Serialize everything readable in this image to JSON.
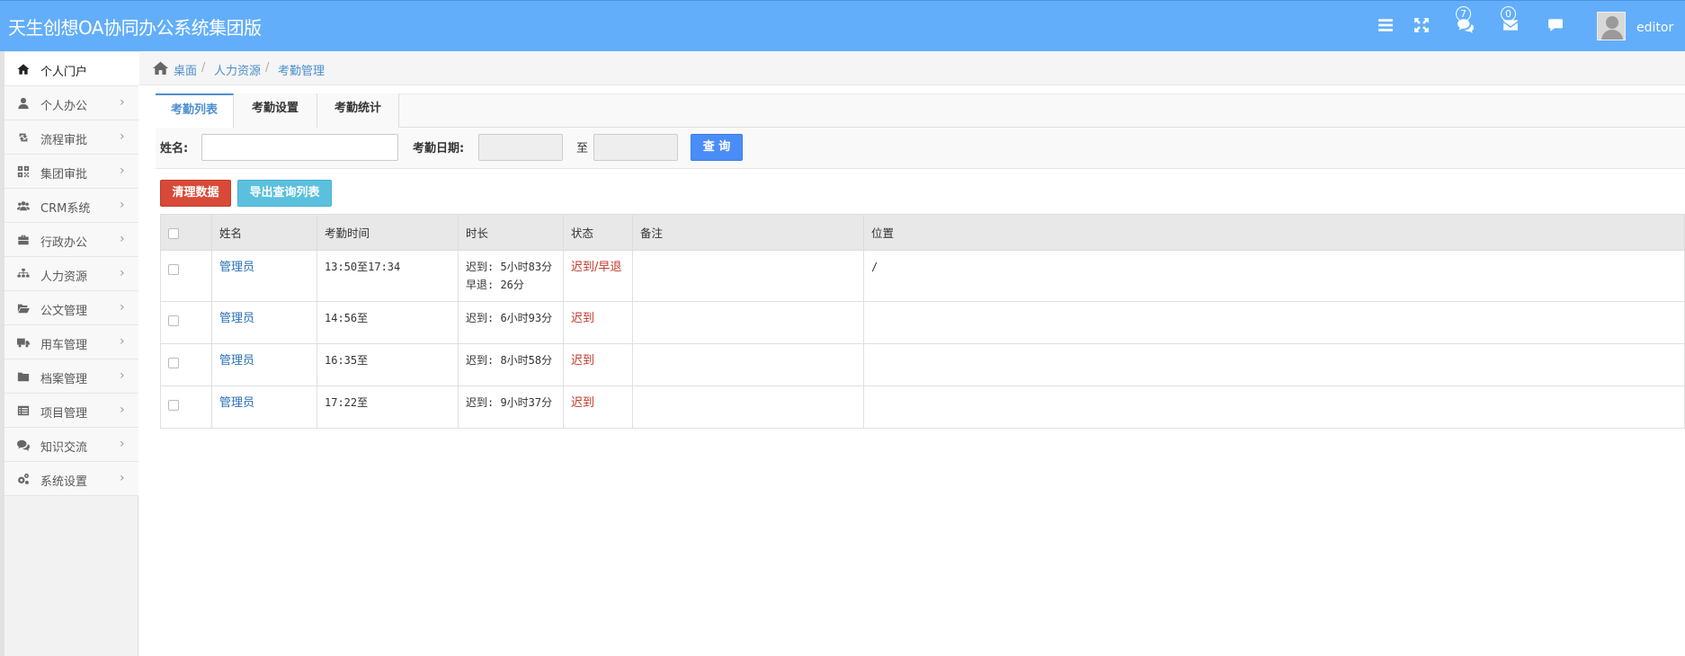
{
  "header": {
    "title": "天生创想OA协同办公系统集团版",
    "messages_badge": "7",
    "mail_badge": "0",
    "username": "editor"
  },
  "sidebar": {
    "items": [
      {
        "label": "个人门户",
        "icon": "home-icon"
      },
      {
        "label": "个人办公",
        "icon": "user-icon"
      },
      {
        "label": "流程审批",
        "icon": "retweet-icon"
      },
      {
        "label": "集团审批",
        "icon": "qrcode-icon"
      },
      {
        "label": "CRM系统",
        "icon": "group-icon"
      },
      {
        "label": "行政办公",
        "icon": "briefcase-icon"
      },
      {
        "label": "人力资源",
        "icon": "sitemap-icon"
      },
      {
        "label": "公文管理",
        "icon": "folder-open-icon"
      },
      {
        "label": "用车管理",
        "icon": "truck-icon"
      },
      {
        "label": "档案管理",
        "icon": "folder-icon"
      },
      {
        "label": "项目管理",
        "icon": "list-alt-icon"
      },
      {
        "label": "知识交流",
        "icon": "comments-icon"
      },
      {
        "label": "系统设置",
        "icon": "cogs-icon"
      }
    ]
  },
  "breadcrumb": {
    "items": [
      "桌面",
      "人力资源",
      "考勤管理"
    ],
    "sep": "/"
  },
  "tabs": [
    {
      "label": "考勤列表",
      "active": true
    },
    {
      "label": "考勤设置",
      "active": false
    },
    {
      "label": "考勤统计",
      "active": false
    }
  ],
  "search": {
    "name_label": "姓名:",
    "name_value": "",
    "date_label": "考勤日期:",
    "date_from": "",
    "to_label": "至",
    "date_to": "",
    "query_button": "查 询"
  },
  "actions": {
    "clear_button": "清理数据",
    "export_button": "导出查询列表"
  },
  "table": {
    "columns": [
      "姓名",
      "考勤时间",
      "时长",
      "状态",
      "备注",
      "位置"
    ],
    "rows": [
      {
        "name": "管理员",
        "time": "13:50至17:34",
        "duration": [
          "迟到: 5小时83分",
          "早退: 26分"
        ],
        "status": "迟到/早退",
        "note": "",
        "location": "/"
      },
      {
        "name": "管理员",
        "time": "14:56至",
        "duration": [
          "迟到: 6小时93分"
        ],
        "status": "迟到",
        "note": "",
        "location": ""
      },
      {
        "name": "管理员",
        "time": "16:35至",
        "duration": [
          "迟到: 8小时58分"
        ],
        "status": "迟到",
        "note": "",
        "location": ""
      },
      {
        "name": "管理员",
        "time": "17:22至",
        "duration": [
          "迟到: 9小时37分"
        ],
        "status": "迟到",
        "note": "",
        "location": ""
      }
    ]
  },
  "colors": {
    "header_bg": "#62aefb",
    "link": "#2870b8",
    "late": "#c0392b",
    "query_btn": "#4b8df8",
    "clear_btn": "#d84a38",
    "export_btn": "#5bc0de"
  }
}
